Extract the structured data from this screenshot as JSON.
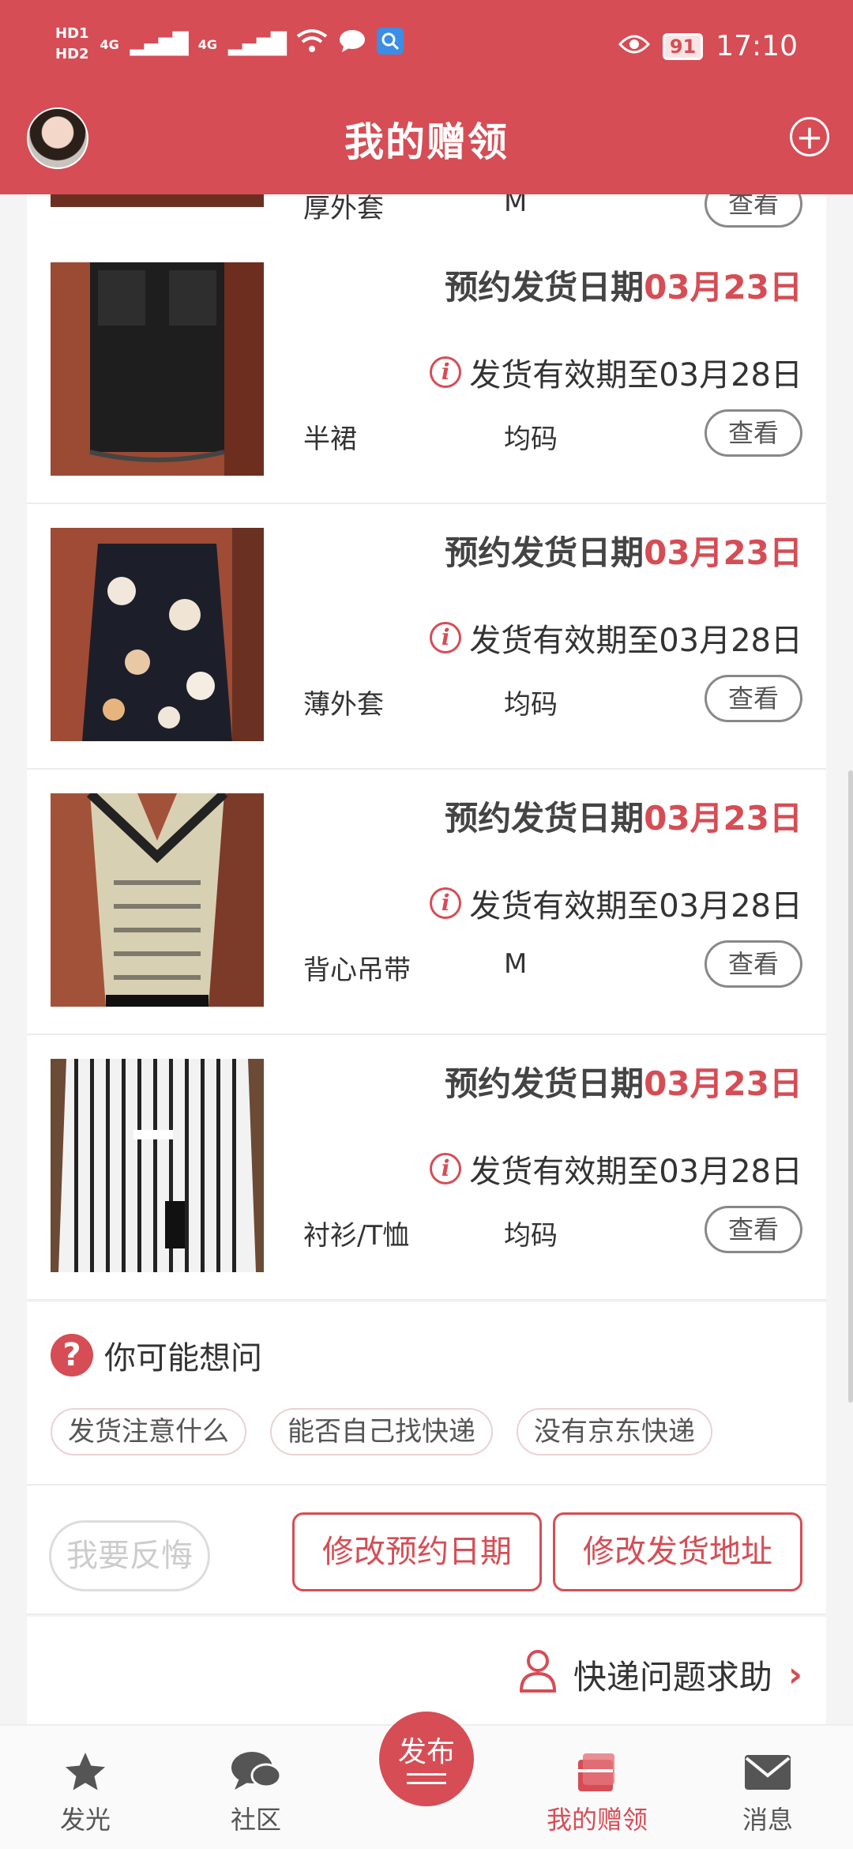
{
  "status_bar": {
    "hd1": "HD1",
    "hd2": "HD2",
    "net1": "4G",
    "net2": "4G",
    "battery": "91",
    "time": "17:10"
  },
  "header": {
    "title": "我的赠领"
  },
  "top_partial_item": {
    "category": "厚外套",
    "size": "M",
    "button": "查看"
  },
  "items": [
    {
      "schedule_label": "预约发货日期",
      "schedule_date": "03月23日",
      "validity": "发货有效期至03月28日",
      "category": "半裙",
      "size": "均码",
      "button": "查看"
    },
    {
      "schedule_label": "预约发货日期",
      "schedule_date": "03月23日",
      "validity": "发货有效期至03月28日",
      "category": "薄外套",
      "size": "均码",
      "button": "查看"
    },
    {
      "schedule_label": "预约发货日期",
      "schedule_date": "03月23日",
      "validity": "发货有效期至03月28日",
      "category": "背心吊带",
      "size": "M",
      "button": "查看"
    },
    {
      "schedule_label": "预约发货日期",
      "schedule_date": "03月23日",
      "validity": "发货有效期至03月28日",
      "category": "衬衫/T恤",
      "size": "均码",
      "button": "查看"
    }
  ],
  "faq": {
    "title": "你可能想问",
    "chips": [
      "发货注意什么",
      "能否自己找快递",
      "没有京东快递"
    ]
  },
  "actions": {
    "regret": "我要反悔",
    "change_date": "修改预约日期",
    "change_address": "修改发货地址"
  },
  "help": {
    "label": "快递问题求助"
  },
  "tabbar": {
    "tabs": [
      {
        "label": "发光",
        "icon": "star-icon"
      },
      {
        "label": "社区",
        "icon": "chat-bubbles-icon"
      },
      {
        "label": "发布",
        "icon": "publish-icon"
      },
      {
        "label": "我的赠领",
        "icon": "gift-box-icon"
      },
      {
        "label": "消息",
        "icon": "envelope-icon"
      }
    ]
  },
  "colors": {
    "primary": "#d64d55",
    "background": "#f4f4f4"
  }
}
